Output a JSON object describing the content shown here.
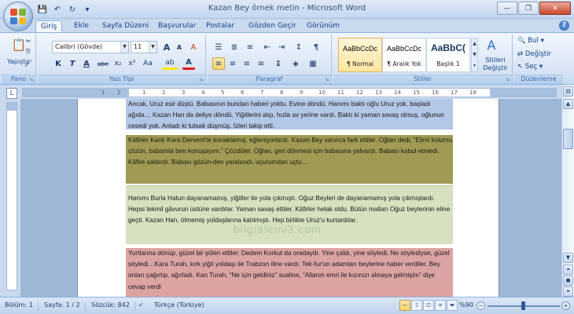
{
  "window": {
    "title": "Kazan Bey örnek metin - Microsoft Word"
  },
  "qat": {
    "save": "💾",
    "undo": "↶",
    "redo": "↻",
    "more": "▾"
  },
  "tabs": [
    "Giriş",
    "Ekle",
    "Sayfa Düzeni",
    "Başvurular",
    "Postalar",
    "Gözden Geçir",
    "Görünüm"
  ],
  "ribbon": {
    "clipboard": {
      "paste_label": "Yapıştır",
      "group_label": "Pano"
    },
    "font": {
      "font_name": "Calibri (Gövde)",
      "font_size": "11",
      "group_label": "Yazı Tipi",
      "bold": "K",
      "italic": "T",
      "underline": "A",
      "strike": "abc",
      "subscript": "x₂",
      "superscript": "x²",
      "case": "Aa",
      "grow": "A",
      "shrink": "A",
      "clear": "A",
      "highlight": "ab",
      "font_color": "A"
    },
    "paragraph": {
      "group_label": "Paragraf",
      "show_marks": "¶"
    },
    "styles": {
      "group_label": "Stiller",
      "items": [
        {
          "sample": "AaBbCcDc",
          "name": "¶ Normal"
        },
        {
          "sample": "AaBbCcDc",
          "name": "¶ Aralık Yok"
        },
        {
          "sample": "AaBbC(",
          "name": "Başlık 1"
        }
      ],
      "change_styles": "Stilleri Değiştir"
    },
    "editing": {
      "group_label": "Düzenleme",
      "find": "Bul",
      "replace": "Değiştir",
      "select": "Seç"
    }
  },
  "ruler": [
    "1",
    "2",
    "1",
    "2",
    "3",
    "4",
    "5",
    "6",
    "7",
    "8",
    "9",
    "10",
    "11",
    "12",
    "13",
    "14",
    "15",
    "16",
    "17",
    "18"
  ],
  "document": {
    "p1": "Ancak, Uruz esir düştü. Babasının bundan haberi yoktu. Evine döndü. Hanımı baktı oğlu Uruz yok, başladı ağıda… Kazan Han da deliye döndü. Yiğitlerini alıp, hızla av yerine vardı. Baktı ki yaman savaş olmuş, oğlunun cesedi yok. Anladı ki tutsak düşmüş. İzleri takip etti.",
    "p2": "Kâfirler Kanlı Kara Dervent'te konaklamış, eğleniyorlardı. Kazan Bey varınca fark ettiler. Oğlan dedi, “Elimi kolumu çözün, babamla ben konuşayım.” Çözdüler. Oğlan, geri dönmesi için babasına yalvardı. Babası kabul etmedi. Kâfire saldırdı. Babası gözün-den yaralandı, uçurumdan uçtu…",
    "p3": "Hanımı Burla Hatun dayanamamış, yiğitler ile yola çıkmıştı. Oğuz Beyleri de dayanamamış yola çıkmışlardı. Hepsi tekmil gâvurun üstüne vardılar. Yaman savaş ettiler. Kâfirler helak oldu. Bütün malları Oğuz beylerinin eline geçti. Kazan Han, ölmemiş yoldaşlarına katılmıştı. Hep birlikte Uruz'u kurtardılar.",
    "p4": "Yurtlarına dönüp, güzel bir şölen ettiler. Dedem Korkut da oradaydı. Yine çaldı, yine söyledi. Ne söylediyse, güzel söyledi…Kara Turah, kırk yiğit yoldaşı ile Trabzon iline vardı. Tek-fur'un adamları beylerine haber verdiler. Bey onları çağırtıp, ağırladı. Kan Turah, “Ne için geldiniz” sualine, “Allanın emri ile kızınızı almaya gelmişim” diye cevap verdi",
    "watermark": "bilgialemi3.com"
  },
  "status": {
    "section": "Bölüm: 1",
    "page": "Sayfa: 1 / 2",
    "words": "Sözcük: 842",
    "language": "Türkçe (Türkiye)",
    "zoom": "%90"
  }
}
